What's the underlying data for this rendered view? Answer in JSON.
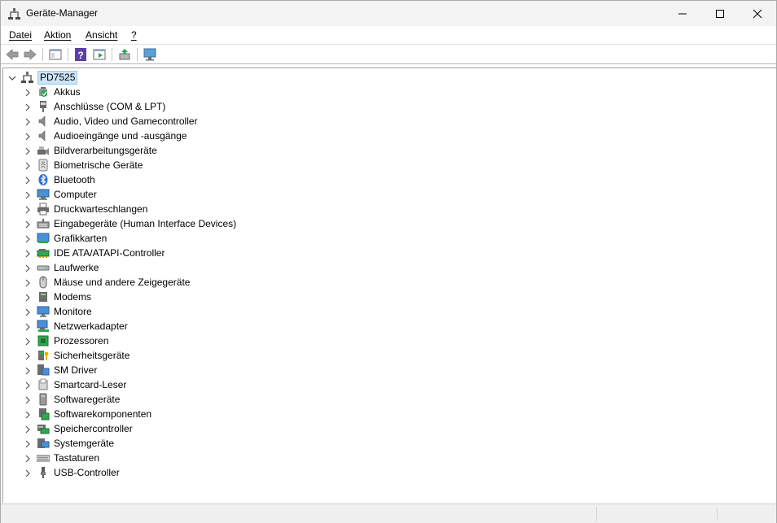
{
  "window": {
    "title": "Geräte-Manager",
    "minimize_icon": "minimize-icon",
    "maximize_icon": "maximize-icon",
    "close_icon": "close-icon"
  },
  "menu": [
    "Datei",
    "Aktion",
    "Ansicht",
    "?"
  ],
  "toolbar": {
    "buttons": [
      "back-icon",
      "forward-icon",
      "show-hide-console-tree-icon",
      "help-icon",
      "properties-icon",
      "update-driver-icon",
      "scan-hardware-icon"
    ]
  },
  "tree": {
    "root": "PD7525",
    "items": [
      {
        "label": "Akkus",
        "icon": "battery-icon"
      },
      {
        "label": "Anschlüsse (COM & LPT)",
        "icon": "port-icon"
      },
      {
        "label": "Audio, Video und Gamecontroller",
        "icon": "speaker-icon"
      },
      {
        "label": "Audioeingänge und -ausgänge",
        "icon": "speaker-icon"
      },
      {
        "label": "Bildverarbeitungsgeräte",
        "icon": "camera-icon"
      },
      {
        "label": "Biometrische Geräte",
        "icon": "fingerprint-icon"
      },
      {
        "label": "Bluetooth",
        "icon": "bluetooth-icon"
      },
      {
        "label": "Computer",
        "icon": "computer-icon"
      },
      {
        "label": "Druckwarteschlangen",
        "icon": "printer-icon"
      },
      {
        "label": "Eingabegeräte (Human Interface Devices)",
        "icon": "hid-icon"
      },
      {
        "label": "Grafikkarten",
        "icon": "display-adapter-icon"
      },
      {
        "label": "IDE ATA/ATAPI-Controller",
        "icon": "ide-controller-icon"
      },
      {
        "label": "Laufwerke",
        "icon": "drive-icon"
      },
      {
        "label": "Mäuse und andere Zeigegeräte",
        "icon": "mouse-icon"
      },
      {
        "label": "Modems",
        "icon": "modem-icon"
      },
      {
        "label": "Monitore",
        "icon": "monitor-icon"
      },
      {
        "label": "Netzwerkadapter",
        "icon": "network-adapter-icon"
      },
      {
        "label": "Prozessoren",
        "icon": "processor-icon"
      },
      {
        "label": "Sicherheitsgeräte",
        "icon": "security-device-icon"
      },
      {
        "label": "SM Driver",
        "icon": "sm-driver-icon"
      },
      {
        "label": "Smartcard-Leser",
        "icon": "smartcard-reader-icon"
      },
      {
        "label": "Softwaregeräte",
        "icon": "software-device-icon"
      },
      {
        "label": "Softwarekomponenten",
        "icon": "software-component-icon"
      },
      {
        "label": "Speichercontroller",
        "icon": "storage-controller-icon"
      },
      {
        "label": "Systemgeräte",
        "icon": "system-device-icon"
      },
      {
        "label": "Tastaturen",
        "icon": "keyboard-icon"
      },
      {
        "label": "USB-Controller",
        "icon": "usb-icon"
      }
    ]
  },
  "colors": {
    "titlebar_bg": "#f3f3f3",
    "selection_bg": "#cce4f7",
    "selection_border": "#99c9ef",
    "chevron": "#555555"
  }
}
